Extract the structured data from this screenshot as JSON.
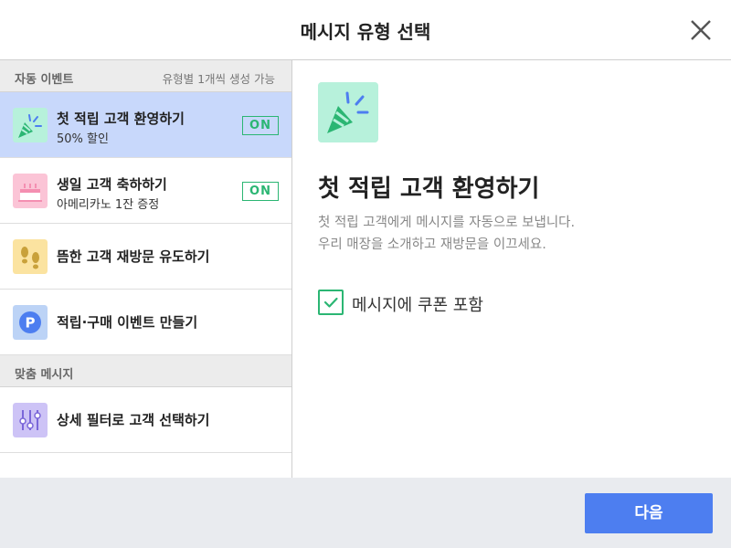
{
  "header": {
    "title": "메시지 유형 선택",
    "close_icon": "close-icon"
  },
  "sidebar": {
    "section_auto": {
      "title": "자동 이벤트",
      "note": "유형별 1개씩 생성 가능"
    },
    "items": [
      {
        "label": "첫 적립 고객 환영하기",
        "sub": "50% 할인",
        "badge": "ON",
        "icon": "party-popper-icon",
        "selected": true
      },
      {
        "label": "생일 고객 축하하기",
        "sub": "아메리카노 1잔 증정",
        "badge": "ON",
        "icon": "birthday-cake-icon",
        "selected": false
      },
      {
        "label": "뜸한 고객 재방문 유도하기",
        "icon": "footprints-icon",
        "selected": false
      },
      {
        "label": "적립·구매 이벤트 만들기",
        "icon": "points-p-icon",
        "selected": false
      }
    ],
    "section_custom": {
      "title": "맞춤 메시지"
    },
    "custom_items": [
      {
        "label": "상세 필터로 고객 선택하기",
        "icon": "filter-sliders-icon"
      }
    ]
  },
  "content": {
    "icon": "party-popper-icon",
    "title": "첫 적립 고객 환영하기",
    "desc_line1": "첫 적립 고객에게 메시지를 자동으로 보냅니다.",
    "desc_line2": "우리 매장을 소개하고 재방문을 이끄세요.",
    "coupon_label": "메시지에 쿠폰 포함",
    "coupon_checked": true
  },
  "footer": {
    "next_label": "다음"
  },
  "colors": {
    "accent": "#4d7ef0",
    "on_green": "#2bb673",
    "selected_row": "#c8d8fb",
    "popper_bg": "#b7f1db",
    "cake_bg": "#fbc4d6",
    "foot_bg": "#fbe3a0",
    "p_bg": "#bcd3f6",
    "filter_bg": "#cdc3f6"
  }
}
